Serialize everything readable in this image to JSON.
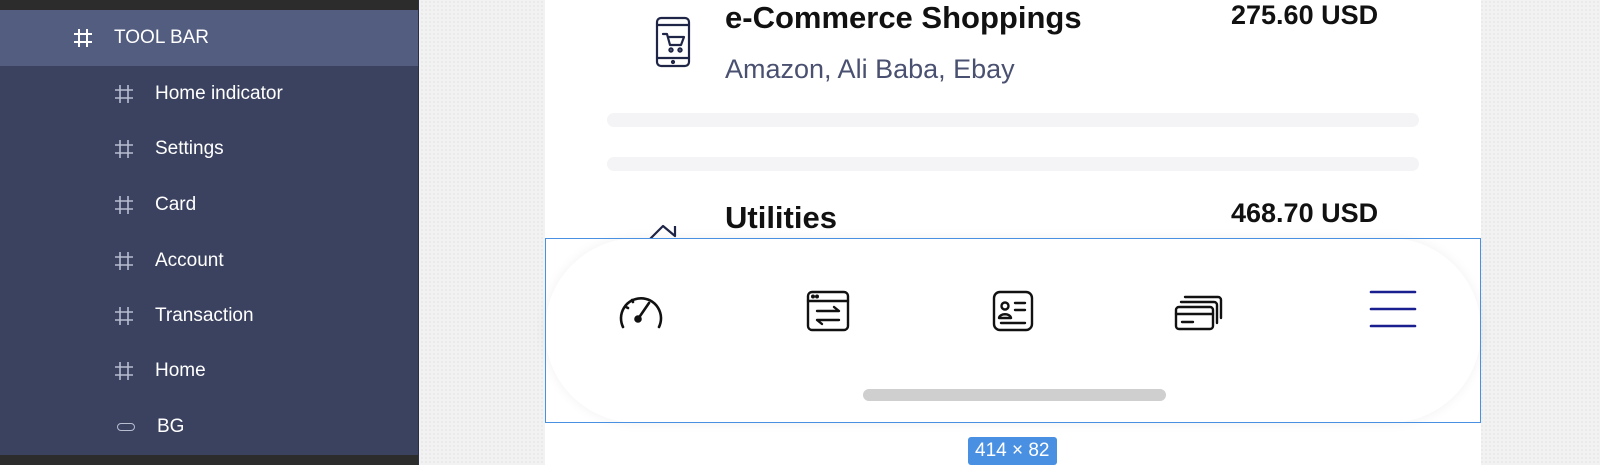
{
  "layers": {
    "items": [
      {
        "label": "TOOL BAR",
        "icon": "frame-hash-icon",
        "selected": true
      },
      {
        "label": "Home indicator",
        "icon": "frame-hash-icon"
      },
      {
        "label": "Settings",
        "icon": "frame-hash-icon"
      },
      {
        "label": "Card",
        "icon": "frame-hash-icon"
      },
      {
        "label": "Account",
        "icon": "frame-hash-icon"
      },
      {
        "label": "Transaction",
        "icon": "frame-hash-icon"
      },
      {
        "label": "Home",
        "icon": "frame-hash-icon"
      },
      {
        "label": "BG",
        "icon": "rectangle-icon"
      }
    ]
  },
  "transactions": [
    {
      "title": "e-Commerce Shoppings",
      "subtitle": "Amazon, Ali Baba, Ebay",
      "amount": "275.60 USD",
      "icon": "mobile-cart-icon"
    },
    {
      "title": "Utilities",
      "amount": "468.70 USD",
      "icon": "house-icon"
    }
  ],
  "toolbar": {
    "icons": [
      "speedometer-icon",
      "transfer-window-icon",
      "id-card-icon",
      "cards-stack-icon",
      "menu-icon"
    ],
    "accent": "#1a1f8f"
  },
  "selection": {
    "size_label": "414 × 82",
    "color": "#4a90e2"
  }
}
